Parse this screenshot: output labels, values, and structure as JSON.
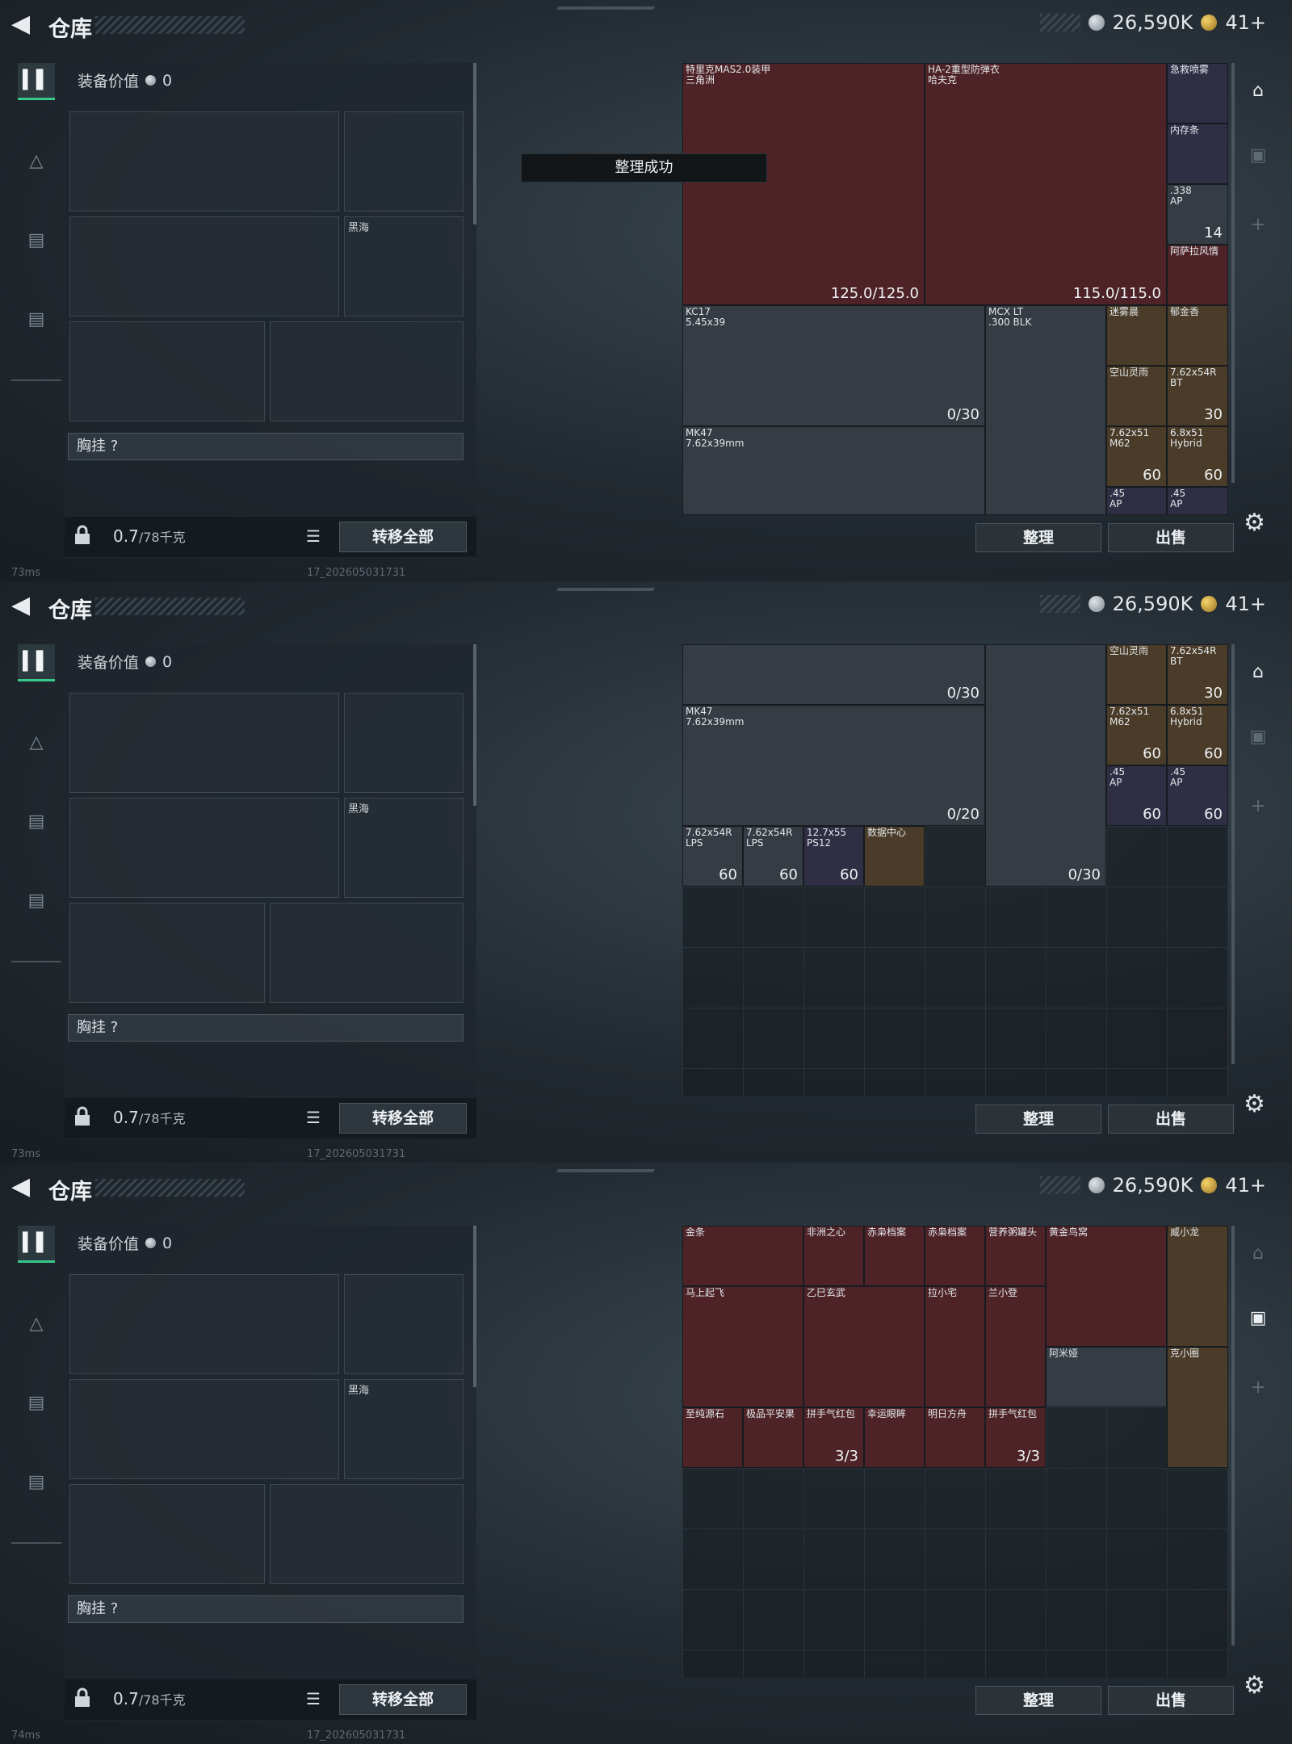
{
  "header": {
    "title": "仓库",
    "money": "26,590K",
    "tickets": "41+"
  },
  "left": {
    "equip_value_label": "装备价值",
    "equip_value": "0",
    "melee_name": "黑海",
    "chest_label": "胸挂",
    "chest_help": "?",
    "weight_value": "0.7",
    "weight_unit": "/78千克",
    "transfer_all": "转移全部"
  },
  "toast": "整理成功",
  "buttons": {
    "sort": "整理",
    "sell": "出售"
  },
  "status": {
    "ping_1": "73ms",
    "ping_2": "73ms",
    "ping_3": "74ms",
    "build": "17_202605031731"
  },
  "panel1_items": [
    {
      "name": "特里克MAS2.0装甲\n三角洲",
      "count": "125.0/125.0"
    },
    {
      "name": "HA-2重型防弹衣\n哈夫克",
      "count": "115.0/115.0"
    },
    {
      "name": "急救喷雾",
      "count": ""
    },
    {
      "name": "内存条",
      "count": ""
    },
    {
      "name": ".338\nAP",
      "count": "14"
    },
    {
      "name": "阿萨拉风情",
      "count": ""
    },
    {
      "name": "KC17\n5.45x39",
      "count": "0/30"
    },
    {
      "name": "MCX LT\n.300 BLK",
      "count": ""
    },
    {
      "name": "迷雾晨",
      "count": ""
    },
    {
      "name": "郁金香",
      "count": ""
    },
    {
      "name": "空山灵雨",
      "count": ""
    },
    {
      "name": "7.62x54R\nBT",
      "count": "30"
    },
    {
      "name": "MK47\n7.62x39mm",
      "count": ""
    },
    {
      "name": "7.62x51\nM62",
      "count": "60"
    },
    {
      "name": "6.8x51\nHybrid",
      "count": "60"
    },
    {
      "name": ".45\nAP",
      "count": ""
    },
    {
      "name": ".45\nAP",
      "count": ""
    }
  ],
  "panel2_items": [
    {
      "name": "",
      "count": "0/30"
    },
    {
      "name": "空山灵雨",
      "count": ""
    },
    {
      "name": "7.62x54R\nBT",
      "count": "30"
    },
    {
      "name": "MK47\n7.62x39mm",
      "count": "0/20"
    },
    {
      "name": "7.62x51\nM62",
      "count": "60"
    },
    {
      "name": "6.8x51\nHybrid",
      "count": "60"
    },
    {
      "name": ".45\nAP",
      "count": "60"
    },
    {
      "name": ".45\nAP",
      "count": "60"
    },
    {
      "name": "7.62x54R\nLPS",
      "count": "60"
    },
    {
      "name": "7.62x54R\nLPS",
      "count": "60"
    },
    {
      "name": "12.7x55\nPS12",
      "count": "60"
    },
    {
      "name": "数据中心",
      "count": ""
    },
    {
      "name": "",
      "count": "0/30"
    }
  ],
  "panel3_items": [
    {
      "name": "金条",
      "count": ""
    },
    {
      "name": "非洲之心",
      "count": ""
    },
    {
      "name": "赤枭档案",
      "count": ""
    },
    {
      "name": "赤枭档案",
      "count": ""
    },
    {
      "name": "营养粥罐头",
      "count": ""
    },
    {
      "name": "黄金鸟窝",
      "count": ""
    },
    {
      "name": "威小龙",
      "count": ""
    },
    {
      "name": "马上起飞",
      "count": ""
    },
    {
      "name": "乙巳玄武",
      "count": ""
    },
    {
      "name": "拉小宅",
      "count": ""
    },
    {
      "name": "兰小登",
      "count": ""
    },
    {
      "name": "阿米娅",
      "count": ""
    },
    {
      "name": "克小圈",
      "count": ""
    },
    {
      "name": "至纯源石",
      "count": ""
    },
    {
      "name": "极品平安果",
      "count": ""
    },
    {
      "name": "拼手气红包",
      "count": "3/3"
    },
    {
      "name": "幸运眼眸",
      "count": ""
    },
    {
      "name": "明日方舟",
      "count": ""
    },
    {
      "name": "拼手气红包",
      "count": "3/3"
    }
  ],
  "icons": [
    "back-icon",
    "coin-icon",
    "ticket-icon",
    "gun-icon",
    "armor-icon",
    "backpack-icon",
    "case-icon",
    "lock-icon",
    "list-icon",
    "gear-icon",
    "home-icon",
    "camera-icon",
    "plus-icon"
  ]
}
